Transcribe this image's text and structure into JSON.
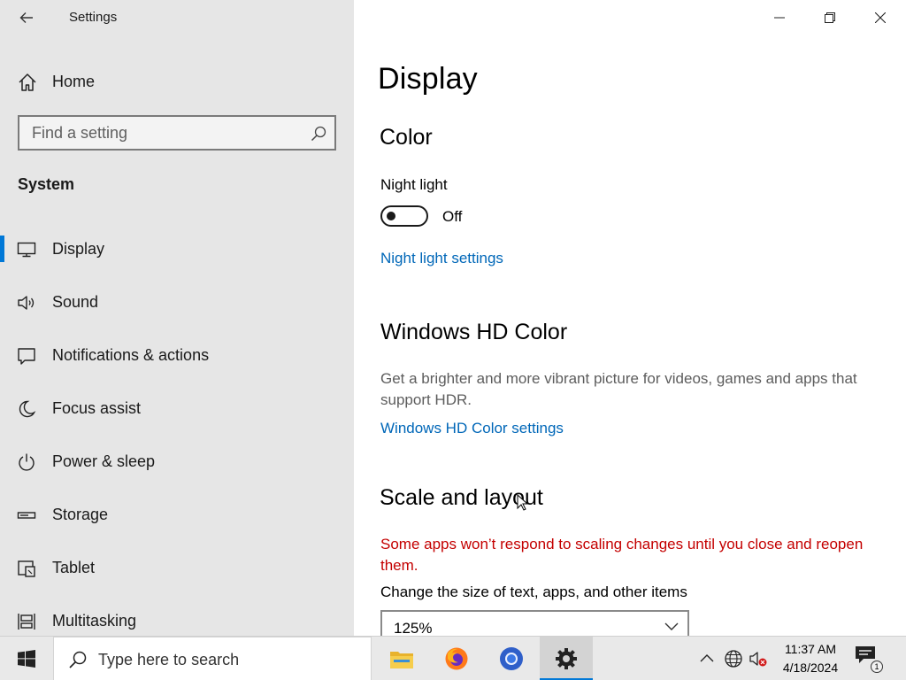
{
  "window": {
    "title": "Settings"
  },
  "sidebar": {
    "home_label": "Home",
    "search_placeholder": "Find a setting",
    "section": "System",
    "items": [
      {
        "label": "Display",
        "icon": "monitor-icon",
        "active": true
      },
      {
        "label": "Sound",
        "icon": "speaker-icon"
      },
      {
        "label": "Notifications & actions",
        "icon": "notification-icon"
      },
      {
        "label": "Focus assist",
        "icon": "moon-icon"
      },
      {
        "label": "Power & sleep",
        "icon": "power-icon"
      },
      {
        "label": "Storage",
        "icon": "storage-icon"
      },
      {
        "label": "Tablet",
        "icon": "tablet-icon"
      },
      {
        "label": "Multitasking",
        "icon": "multitasking-icon"
      }
    ]
  },
  "main": {
    "title": "Display",
    "color": {
      "heading": "Color",
      "night_light_label": "Night light",
      "night_light_state": "Off",
      "night_light_link": "Night light settings"
    },
    "hd_color": {
      "heading": "Windows HD Color",
      "description": "Get a brighter and more vibrant picture for videos, games and apps that support HDR.",
      "link": "Windows HD Color settings"
    },
    "scale": {
      "heading": "Scale and layout",
      "warning": "Some apps won’t respond to scaling changes until you close and reopen them.",
      "size_label": "Change the size of text, apps, and other items",
      "size_value": "125%"
    }
  },
  "taskbar": {
    "search_placeholder": "Type here to search",
    "time": "11:37 AM",
    "date": "4/18/2024",
    "notification_count": "1",
    "apps": [
      "file-explorer-icon",
      "firefox-icon",
      "chrome-icon",
      "settings-icon"
    ]
  },
  "colors": {
    "accent": "#0078d7",
    "link": "#0067b8",
    "warning": "#c40000",
    "sidebar_bg": "#e6e6e6"
  }
}
